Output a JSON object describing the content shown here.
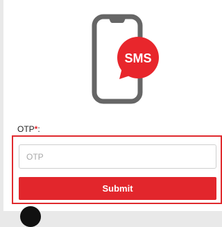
{
  "illustration": {
    "icon": "phone-sms-icon",
    "bubble_text": "SMS",
    "colors": {
      "phone": "#666666",
      "bubble": "#e8262c",
      "bubble_text": "#ffffff"
    }
  },
  "otp_field": {
    "label": "OTP",
    "required_marker": "*",
    "label_suffix": ":",
    "placeholder": "OTP",
    "value": ""
  },
  "submit": {
    "label": "Submit",
    "color": "#e2262c"
  },
  "colors": {
    "accent": "#e02a2e",
    "page_background": "#ffffff",
    "outer_background": "#e9e9e9"
  }
}
